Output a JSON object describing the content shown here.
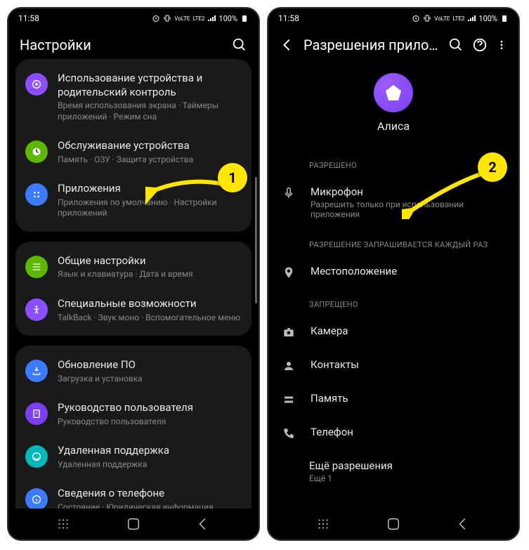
{
  "status": {
    "time": "11:58",
    "network": "LTE2",
    "signal_text": "VoLTE",
    "battery": "100%"
  },
  "phone1": {
    "title": "Настройки",
    "groups": [
      {
        "items": [
          {
            "title": "Использование устройства и родительский контроль",
            "sub": "Время использования экрана · Таймеры приложений · Режим сна",
            "color": "#8c4fff",
            "icon": "wellbeing"
          },
          {
            "title": "Обслуживание устройства",
            "sub": "Память · ОЗУ · Защита устройства",
            "color": "#5fb800",
            "icon": "care"
          },
          {
            "title": "Приложения",
            "sub": "Приложения по умолчанию · Настройки приложений",
            "color": "#3a7bff",
            "icon": "apps"
          }
        ]
      },
      {
        "items": [
          {
            "title": "Общие настройки",
            "sub": "Язык и клавиатура · Дата и время",
            "color": "#5fb800",
            "icon": "general"
          },
          {
            "title": "Специальные возможности",
            "sub": "TalkBack · Звук моно · Вспомогательное меню",
            "color": "#8c4fff",
            "icon": "accessibility"
          }
        ]
      },
      {
        "items": [
          {
            "title": "Обновление ПО",
            "sub": "Загрузка и установка",
            "color": "#3a7bff",
            "icon": "update"
          },
          {
            "title": "Руководство пользователя",
            "sub": "Руководство пользователя",
            "color": "#7b3ff0",
            "icon": "manual"
          },
          {
            "title": "Удаленная поддержка",
            "sub": "Удаленная поддержка",
            "color": "#00b8b8",
            "icon": "support"
          },
          {
            "title": "Сведения о телефоне",
            "sub": "Состояние · Юридическая информация",
            "color": "#3a7bff",
            "icon": "about"
          }
        ]
      }
    ]
  },
  "phone2": {
    "title": "Разрешения прилож…",
    "app_name": "Алиса",
    "sections": {
      "allowed": {
        "label": "РАЗРЕШЕНО",
        "items": [
          {
            "title": "Микрофон",
            "sub": "Разрешить только при использовании приложения",
            "icon": "mic"
          }
        ]
      },
      "ask": {
        "label": "РАЗРЕШЕНИЕ ЗАПРАШИВАЕТСЯ КАЖДЫЙ РАЗ",
        "items": [
          {
            "title": "Местоположение",
            "icon": "location"
          }
        ]
      },
      "denied": {
        "label": "ЗАПРЕЩЕНО",
        "items": [
          {
            "title": "Камера",
            "icon": "camera"
          },
          {
            "title": "Контакты",
            "icon": "contacts"
          },
          {
            "title": "Память",
            "icon": "storage"
          },
          {
            "title": "Телефон",
            "icon": "phone"
          }
        ]
      }
    },
    "more": {
      "title": "Ещё разрешения",
      "sub": "Ещё 1"
    }
  },
  "annotations": {
    "badge1": "1",
    "badge2": "2"
  }
}
